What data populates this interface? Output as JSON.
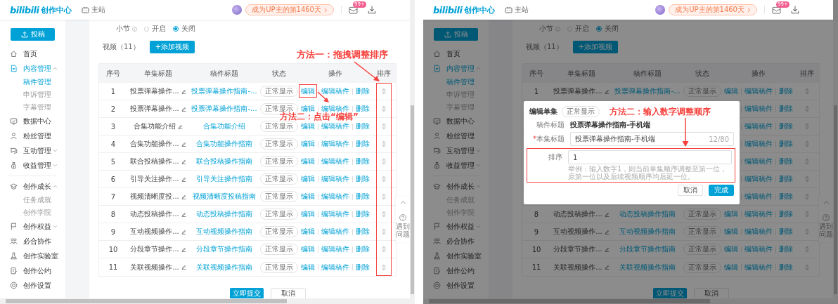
{
  "panels": [
    {
      "header": {
        "logo": "bilibili",
        "title": "创作中心",
        "home_link": "主站",
        "streak": "成为UP主的第1460天",
        "mail_badge": "99+"
      },
      "sidebar": {
        "upload_button": "投稿",
        "groups": [
          {
            "items": [
              {
                "label": "首页",
                "selected": false
              },
              {
                "label": "内容管理",
                "selected": true,
                "expanded": true,
                "children": [
                  {
                    "label": "稿件管理",
                    "selected": true
                  },
                  {
                    "label": "申诉管理",
                    "selected": false
                  },
                  {
                    "label": "字幕管理",
                    "selected": false
                  }
                ]
              },
              {
                "label": "数据中心",
                "selected": false
              },
              {
                "label": "粉丝管理",
                "selected": false
              },
              {
                "label": "互动管理",
                "selected": false,
                "expanded": false
              },
              {
                "label": "收益管理",
                "selected": false,
                "expanded": false
              }
            ]
          },
          {
            "items": [
              {
                "label": "创作成长",
                "selected": false,
                "expanded": true,
                "children": [
                  {
                    "label": "任务成就",
                    "selected": false
                  },
                  {
                    "label": "创作学院",
                    "selected": false
                  }
                ]
              },
              {
                "label": "创作权益",
                "selected": false,
                "expanded": false
              },
              {
                "label": "必合协作",
                "selected": false
              },
              {
                "label": "创作实验室",
                "selected": false
              },
              {
                "label": "创作公约",
                "selected": false
              },
              {
                "label": "创作设置",
                "selected": false
              }
            ]
          }
        ]
      },
      "section": {
        "label": "小节",
        "options": [
          {
            "label": "开启",
            "selected": false
          },
          {
            "label": "关闭",
            "selected": true
          }
        ]
      },
      "videos": {
        "label": "视频（11）",
        "add_button": "+添加视频"
      },
      "table": {
        "columns": [
          "序号",
          "单集标题",
          "稿件标题",
          "状态",
          "操作",
          "排序"
        ],
        "rows": [
          {
            "index": "1",
            "episode_title": "投票弹幕操作...",
            "draft_title": "投票弹幕操作指南-...",
            "status": "正常显示",
            "actions": [
              {
                "kind": "edit",
                "label": "编辑"
              },
              {
                "kind": "edit_draft",
                "label": "编辑稿件"
              },
              {
                "kind": "delete",
                "label": "删除"
              }
            ]
          },
          {
            "index": "2",
            "episode_title": "投票弹幕操作...",
            "draft_title": "投票弹幕操作指南-...",
            "status": "正常显示",
            "actions": [
              {
                "kind": "edit",
                "label": "编辑"
              },
              {
                "kind": "edit_draft",
                "label": "编辑稿件"
              },
              {
                "kind": "delete",
                "label": "删除"
              }
            ]
          },
          {
            "index": "3",
            "episode_title": "合集功能介绍",
            "draft_title": "合集功能介绍",
            "status": "正常显示",
            "actions": [
              {
                "kind": "edit",
                "label": "编辑"
              },
              {
                "kind": "edit_draft",
                "label": "编辑稿件"
              },
              {
                "kind": "delete",
                "label": "删除"
              }
            ]
          },
          {
            "index": "4",
            "episode_title": "合集功能操作...",
            "draft_title": "合集功能操作指南",
            "status": "正常显示",
            "actions": [
              {
                "kind": "edit",
                "label": "编辑"
              },
              {
                "kind": "edit_draft",
                "label": "编辑稿件"
              },
              {
                "kind": "delete",
                "label": "删除"
              }
            ]
          },
          {
            "index": "5",
            "episode_title": "联合投稿操作...",
            "draft_title": "联合投稿操作指南",
            "status": "正常显示",
            "actions": [
              {
                "kind": "edit",
                "label": "编辑"
              },
              {
                "kind": "edit_draft",
                "label": "编辑稿件"
              },
              {
                "kind": "delete",
                "label": "删除"
              }
            ]
          },
          {
            "index": "6",
            "episode_title": "引导关注操作...",
            "draft_title": "引导关注操作指南",
            "status": "正常显示",
            "actions": [
              {
                "kind": "edit",
                "label": "编辑"
              },
              {
                "kind": "edit_draft",
                "label": "编辑稿件"
              },
              {
                "kind": "delete",
                "label": "删除"
              }
            ]
          },
          {
            "index": "7",
            "episode_title": "视频清晰度投...",
            "draft_title": "视频清晰度投稿指南",
            "status": "正常显示",
            "actions": [
              {
                "kind": "edit",
                "label": "编辑"
              },
              {
                "kind": "edit_draft",
                "label": "编辑稿件"
              },
              {
                "kind": "delete",
                "label": "删除"
              }
            ]
          },
          {
            "index": "8",
            "episode_title": "动态投稿操作...",
            "draft_title": "动态投稿操作指南",
            "status": "正常显示",
            "actions": [
              {
                "kind": "edit",
                "label": "编辑"
              },
              {
                "kind": "edit_draft",
                "label": "编辑稿件"
              },
              {
                "kind": "delete",
                "label": "删除"
              }
            ]
          },
          {
            "index": "9",
            "episode_title": "互动视频操作...",
            "draft_title": "互动视频操作指南",
            "status": "正常显示",
            "actions": [
              {
                "kind": "edit",
                "label": "编辑"
              },
              {
                "kind": "edit_draft",
                "label": "编辑稿件"
              },
              {
                "kind": "delete",
                "label": "删除"
              }
            ]
          },
          {
            "index": "10",
            "episode_title": "分段章节操作...",
            "draft_title": "分段章节操作指南",
            "status": "正常显示",
            "actions": [
              {
                "kind": "edit",
                "label": "编辑"
              },
              {
                "kind": "edit_draft",
                "label": "编辑稿件"
              },
              {
                "kind": "delete",
                "label": "删除"
              }
            ]
          },
          {
            "index": "11",
            "episode_title": "关联视频操作...",
            "draft_title": "关联视频操作指南",
            "status": "正常显示",
            "actions": [
              {
                "kind": "edit",
                "label": "编辑"
              },
              {
                "kind": "edit_draft",
                "label": "编辑稿件"
              },
              {
                "kind": "delete",
                "label": "删除"
              }
            ]
          }
        ]
      },
      "footer": {
        "submit": "立即提交",
        "cancel": "取消"
      },
      "help": "遇到问题",
      "annotations": [
        {
          "text": "方法一：拖拽调整排序"
        },
        {
          "text": "方法二：点击“编辑”"
        }
      ]
    },
    {
      "header": {
        "logo": "bilibili",
        "title": "创作中心",
        "home_link": "主站",
        "streak": "成为UP主的第1460天",
        "mail_badge": "99+"
      },
      "sidebar": {
        "upload_button": "投稿",
        "groups": [
          {
            "items": [
              {
                "label": "首页",
                "selected": false
              },
              {
                "label": "内容管理",
                "selected": true,
                "expanded": true,
                "children": [
                  {
                    "label": "稿件管理",
                    "selected": true
                  },
                  {
                    "label": "申诉管理",
                    "selected": false
                  },
                  {
                    "label": "字幕管理",
                    "selected": false
                  }
                ]
              },
              {
                "label": "数据中心",
                "selected": false
              },
              {
                "label": "粉丝管理",
                "selected": false
              },
              {
                "label": "互动管理",
                "selected": false,
                "expanded": false
              },
              {
                "label": "收益管理",
                "selected": false,
                "expanded": false
              }
            ]
          },
          {
            "items": [
              {
                "label": "创作成长",
                "selected": false,
                "expanded": true,
                "children": [
                  {
                    "label": "任务成就",
                    "selected": false
                  },
                  {
                    "label": "创作学院",
                    "selected": false
                  }
                ]
              },
              {
                "label": "创作权益",
                "selected": false,
                "expanded": false
              },
              {
                "label": "必合协作",
                "selected": false
              },
              {
                "label": "创作实验室",
                "selected": false
              },
              {
                "label": "创作公约",
                "selected": false
              },
              {
                "label": "创作设置",
                "selected": false
              }
            ]
          }
        ]
      },
      "section": {
        "label": "小节",
        "options": [
          {
            "label": "开启",
            "selected": false
          },
          {
            "label": "关闭",
            "selected": true
          }
        ]
      },
      "videos": {
        "label": "视频（11）",
        "add_button": "+添加视频"
      },
      "table": {
        "columns": [
          "序号",
          "单集标题",
          "稿件标题",
          "状态",
          "操作",
          "排序"
        ],
        "rows": [
          {
            "index": "1",
            "episode_title": "投票弹幕操作...",
            "draft_title": "投票弹幕操作指南-...",
            "status": "正常显示",
            "actions": [
              {
                "kind": "edit",
                "label": "编辑"
              },
              {
                "kind": "edit_draft",
                "label": "编辑稿件"
              },
              {
                "kind": "delete",
                "label": "删除"
              }
            ]
          },
          {
            "actions": [
              {
                "kind": "edit_draft",
                "label": "编辑稿件"
              },
              {
                "kind": "delete",
                "label": "删除"
              }
            ]
          },
          {
            "actions": [
              {
                "kind": "edit_draft",
                "label": "编辑稿件"
              },
              {
                "kind": "delete",
                "label": "删除"
              }
            ]
          },
          {
            "actions": [
              {
                "kind": "edit_draft",
                "label": "编辑稿件"
              },
              {
                "kind": "delete",
                "label": "删除"
              }
            ]
          },
          {
            "actions": [
              {
                "kind": "edit_draft",
                "label": "编辑稿件"
              },
              {
                "kind": "delete",
                "label": "删除"
              }
            ]
          },
          {
            "actions": [
              {
                "kind": "edit_draft",
                "label": "编辑稿件"
              },
              {
                "kind": "delete",
                "label": "删除"
              }
            ]
          },
          {
            "actions": [
              {
                "kind": "edit_draft",
                "label": "编辑稿件"
              },
              {
                "kind": "delete",
                "label": "删除"
              }
            ]
          },
          {
            "index": "8",
            "episode_title": "动态投稿操作...",
            "draft_title": "动态投稿操作指南",
            "status": "正常显示",
            "actions": [
              {
                "kind": "edit",
                "label": "编辑"
              },
              {
                "kind": "edit_draft",
                "label": "编辑稿件"
              },
              {
                "kind": "delete",
                "label": "删除"
              }
            ]
          },
          {
            "index": "9",
            "episode_title": "互动视频操作...",
            "draft_title": "互动视频操作指南",
            "status": "正常显示",
            "actions": [
              {
                "kind": "edit",
                "label": "编辑"
              },
              {
                "kind": "edit_draft",
                "label": "编辑稿件"
              },
              {
                "kind": "delete",
                "label": "删除"
              }
            ]
          },
          {
            "index": "10",
            "episode_title": "分段章节操作...",
            "draft_title": "分段章节操作指南",
            "status": "正常显示",
            "actions": [
              {
                "kind": "edit",
                "label": "编辑"
              },
              {
                "kind": "edit_draft",
                "label": "编辑稿件"
              },
              {
                "kind": "delete",
                "label": "删除"
              }
            ]
          },
          {
            "index": "11",
            "episode_title": "关联视频操作...",
            "draft_title": "关联视频操作指南",
            "status": "正常显示",
            "actions": [
              {
                "kind": "edit",
                "label": "编辑"
              },
              {
                "kind": "edit_draft",
                "label": "编辑稿件"
              },
              {
                "kind": "delete",
                "label": "删除"
              }
            ]
          }
        ]
      },
      "footer": {
        "submit": "立即提交",
        "cancel": "取消"
      },
      "help": "遇到问题",
      "modal": {
        "title": "编辑单集",
        "status": "正常显示",
        "annotation": "方法二：输入数字调整顺序",
        "draft": {
          "label": "稿件标题",
          "value": "投票弹幕操作指南-手机端"
        },
        "episode": {
          "label": "本集标题",
          "required_mark": "*",
          "value": "投票弹幕操作指南-手机端",
          "counter": "12/80"
        },
        "order": {
          "label": "排序",
          "value": "1",
          "hint": "举例：输入数字1，则当前单集顺序调整至第一位，原第一位以及后续视频顺序均后延一位。"
        },
        "buttons": [
          {
            "label": "取消",
            "primary": false
          },
          {
            "label": "完成",
            "primary": true
          }
        ]
      }
    }
  ]
}
